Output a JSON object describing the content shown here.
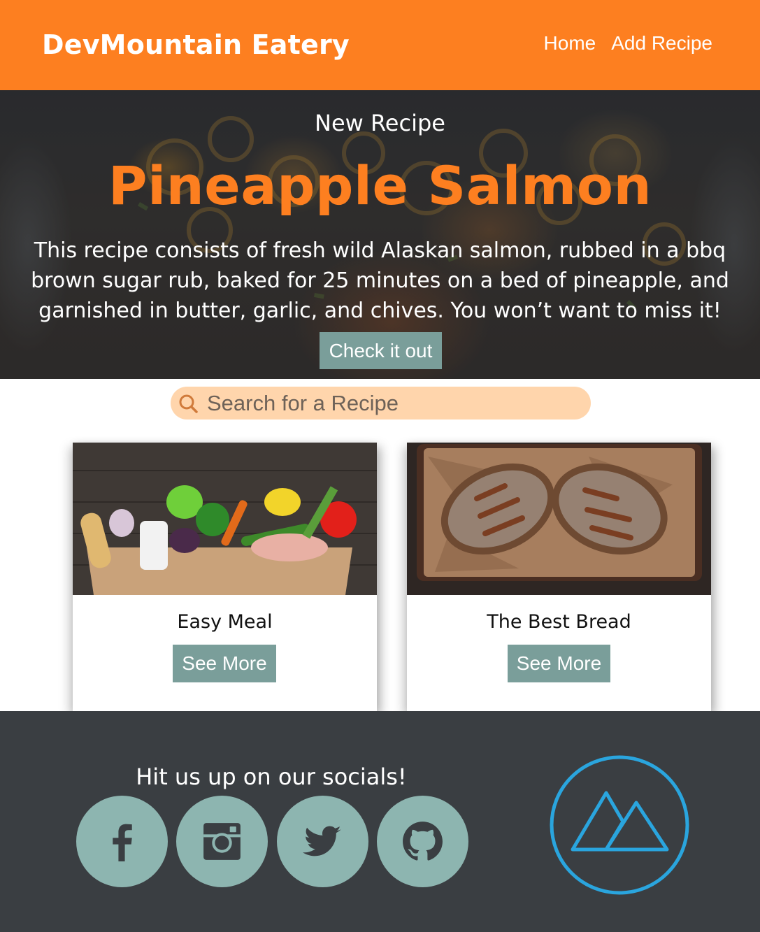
{
  "header": {
    "brand": "DevMountain Eatery",
    "nav": [
      "Home",
      "Add Recipe"
    ],
    "color": "#fd7f20"
  },
  "hero": {
    "label": "New Recipe",
    "title": "Pineapple Salmon",
    "description": "This recipe consists of fresh wild Alaskan salmon, rubbed in a bbq brown sugar rub, baked for 25 minutes on a bed of pineapple, and garnished in butter, garlic, and chives. You won’t want to miss it!",
    "button": "Check it out"
  },
  "search": {
    "placeholder": "Search for a Recipe",
    "value": "",
    "icon": "search-icon"
  },
  "cards": [
    {
      "title": "Easy Meal",
      "button": "See More",
      "image": "grocery-bag-vegetables"
    },
    {
      "title": "The Best Bread",
      "button": "See More",
      "image": "bread-loaves-on-tray"
    }
  ],
  "footer": {
    "heading": "Hit us up on our socials!",
    "socials": [
      "facebook-icon",
      "instagram-icon",
      "twitter-icon",
      "github-icon"
    ],
    "logo": "devmountain-logo",
    "social_color": "#8db5b0",
    "logo_color": "#2aa5de"
  },
  "colors": {
    "accent": "#fd7f20",
    "button": "#7a9e9a",
    "search_bg": "#ffd5ac",
    "footer_bg": "#3a3e42"
  }
}
